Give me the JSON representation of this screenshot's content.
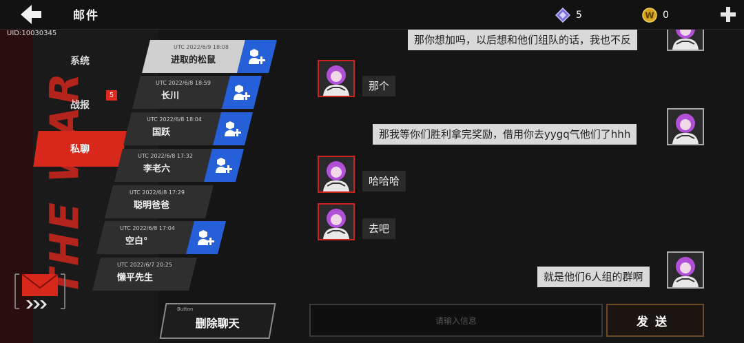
{
  "header": {
    "title": "邮件",
    "uid": "UID:10030345"
  },
  "currency": {
    "gems": "5",
    "coins": "0"
  },
  "sidebar": {
    "tabs": [
      {
        "label": "系统"
      },
      {
        "label": "战报",
        "badge": "5"
      },
      {
        "label": "私聊"
      }
    ]
  },
  "contacts": [
    {
      "time": "UTC 2022/6/9 18:08",
      "name": "进取的松鼠"
    },
    {
      "time": "UTC 2022/6/8 18:59",
      "name": "长川"
    },
    {
      "time": "UTC 2022/6/8 18:04",
      "name": "国跃"
    },
    {
      "time": "UTC 2022/6/8 17:32",
      "name": "李老六"
    },
    {
      "time": "UTC 2022/6/8 17:29",
      "name": "聪明爸爸"
    },
    {
      "time": "UTC 2022/6/8 17:04",
      "name": "空白°"
    },
    {
      "time": "UTC 2022/6/7 20:25",
      "name": "懒平先生"
    }
  ],
  "messages": [
    {
      "from": "me",
      "text": "那你想加吗，以后想和他们组队的话，我也不反"
    },
    {
      "from": "them",
      "text": "那个"
    },
    {
      "from": "me",
      "text": "那我等你们胜利拿完奖励，借用你去yygq气他们了hhh"
    },
    {
      "from": "them",
      "text": "哈哈哈"
    },
    {
      "from": "them",
      "text": "去吧"
    },
    {
      "from": "me",
      "text": "就是他们6人组的群啊"
    }
  ],
  "footer": {
    "delete_small": "Button",
    "delete_label": "删除聊天",
    "input_placeholder": "请输入信息",
    "send_label": "发送"
  },
  "deco_text": "THE WAR",
  "colors": {
    "accent_red": "#d8281b",
    "add_blue": "#2560d8",
    "send_border": "#6b4a25"
  }
}
